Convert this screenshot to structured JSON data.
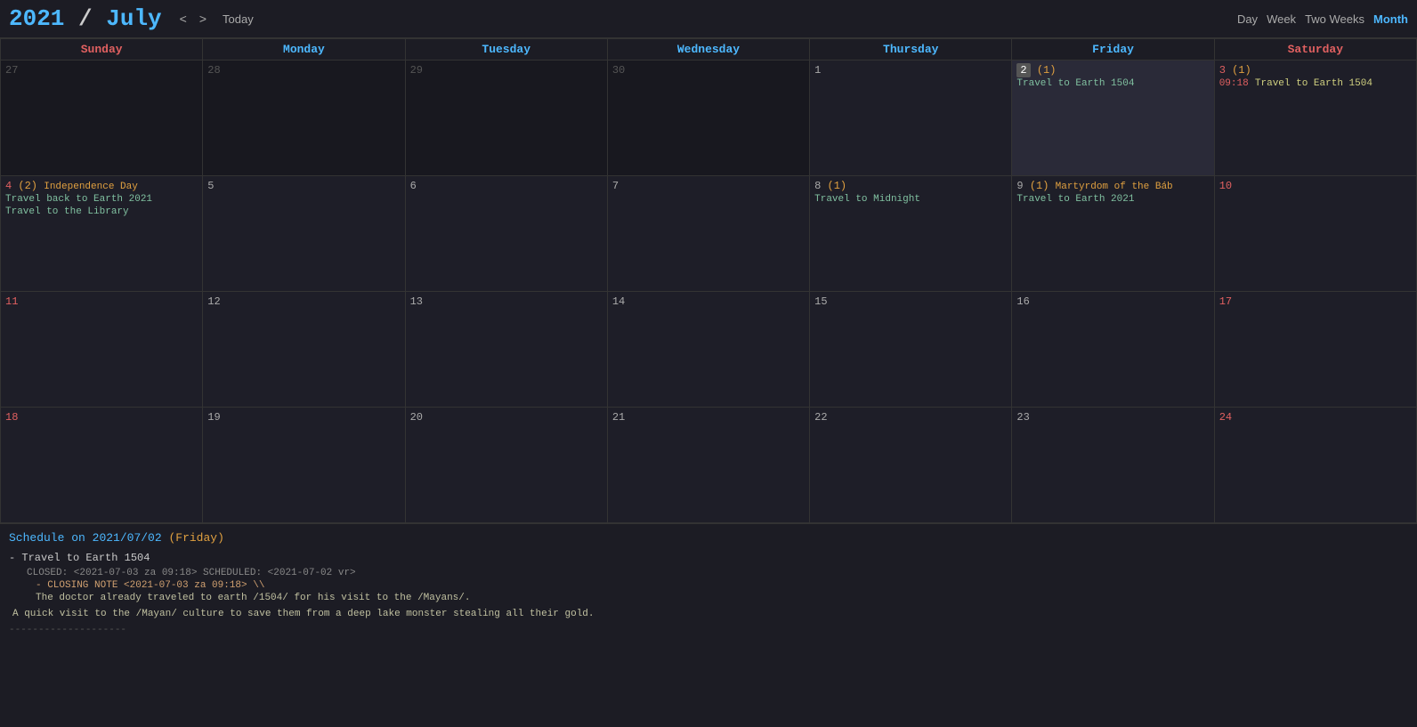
{
  "header": {
    "year": "2021",
    "slash": " / ",
    "month": "July",
    "nav": {
      "prev": "<",
      "next": ">",
      "today": "Today"
    },
    "views": [
      "Day",
      "Week",
      "Two Weeks",
      "Month"
    ],
    "active_view": "Month"
  },
  "day_headers": [
    {
      "label": "Sunday",
      "class": "sunday"
    },
    {
      "label": "Monday",
      "class": "weekday"
    },
    {
      "label": "Tuesday",
      "class": "weekday"
    },
    {
      "label": "Wednesday",
      "class": "weekday"
    },
    {
      "label": "Thursday",
      "class": "weekday"
    },
    {
      "label": "Friday",
      "class": "weekday"
    },
    {
      "label": "Saturday",
      "class": "saturday"
    }
  ],
  "weeks": [
    {
      "days": [
        {
          "num": "27",
          "class": "gray",
          "events": [],
          "other": true
        },
        {
          "num": "28",
          "class": "",
          "events": [],
          "other": true
        },
        {
          "num": "29",
          "class": "",
          "events": [],
          "other": true
        },
        {
          "num": "30",
          "class": "",
          "events": [],
          "other": true
        },
        {
          "num": "1",
          "class": "",
          "events": [],
          "other": false
        },
        {
          "num": "2",
          "class": "",
          "highlighted": true,
          "count": "(1)",
          "events": [
            {
              "label": "Travel to Earth 1504",
              "time": ""
            }
          ],
          "other": false
        },
        {
          "num": "3",
          "class": "saturday",
          "count": "(1)",
          "events": [
            {
              "label": "Travel to Earth 1504",
              "time": "09:18"
            }
          ],
          "other": false
        }
      ]
    },
    {
      "days": [
        {
          "num": "4",
          "class": "sunday",
          "count": "(2)",
          "holiday": "Independence Day",
          "events": [
            {
              "label": "Travel back to Earth 2021"
            },
            {
              "label": "Travel to the Library"
            }
          ],
          "other": false
        },
        {
          "num": "5",
          "class": "",
          "events": [],
          "other": false
        },
        {
          "num": "6",
          "class": "",
          "events": [],
          "other": false
        },
        {
          "num": "7",
          "class": "",
          "events": [],
          "other": false
        },
        {
          "num": "8",
          "class": "",
          "count": "(1)",
          "events": [
            {
              "label": "Travel to Midnight"
            }
          ],
          "other": false
        },
        {
          "num": "9",
          "class": "",
          "count": "(1)",
          "holiday": "Martyrdom of the Báb",
          "events": [
            {
              "label": "Travel to Earth 2021"
            }
          ],
          "other": false
        },
        {
          "num": "10",
          "class": "saturday",
          "events": [],
          "other": false
        }
      ]
    },
    {
      "days": [
        {
          "num": "11",
          "class": "sunday",
          "events": [],
          "other": false
        },
        {
          "num": "12",
          "class": "",
          "events": [],
          "other": false
        },
        {
          "num": "13",
          "class": "",
          "events": [],
          "other": false
        },
        {
          "num": "14",
          "class": "",
          "events": [],
          "other": false
        },
        {
          "num": "15",
          "class": "",
          "events": [],
          "other": false
        },
        {
          "num": "16",
          "class": "",
          "events": [],
          "other": false
        },
        {
          "num": "17",
          "class": "saturday",
          "events": [],
          "other": false
        }
      ]
    },
    {
      "days": [
        {
          "num": "18",
          "class": "sunday",
          "events": [],
          "other": false
        },
        {
          "num": "19",
          "class": "",
          "events": [],
          "other": false
        },
        {
          "num": "20",
          "class": "",
          "events": [],
          "other": false
        },
        {
          "num": "21",
          "class": "",
          "events": [],
          "other": false
        },
        {
          "num": "22",
          "class": "",
          "events": [],
          "other": false
        },
        {
          "num": "23",
          "class": "",
          "events": [],
          "other": false
        },
        {
          "num": "24",
          "class": "saturday",
          "events": [],
          "other": false
        }
      ]
    }
  ],
  "schedule": {
    "title_prefix": "Schedule on",
    "date": "2021/07/02",
    "day_label": "(Friday)",
    "events": [
      {
        "bullet": "-",
        "name": "Travel to Earth 1504",
        "meta": "CLOSED: <2021-07-03 za 09:18> SCHEDULED: <2021-07-02 vr>",
        "closing_note_label": "- CLOSING NOTE <2021-07-03 za 09:18> \\\\",
        "closing_body": "The doctor already traveled to earth /1504/ for his visit to the /Mayans/.",
        "description": "A quick visit to the /Mayan/ culture to save them from a deep lake monster stealing all their gold."
      }
    ],
    "divider": "--------------------"
  }
}
